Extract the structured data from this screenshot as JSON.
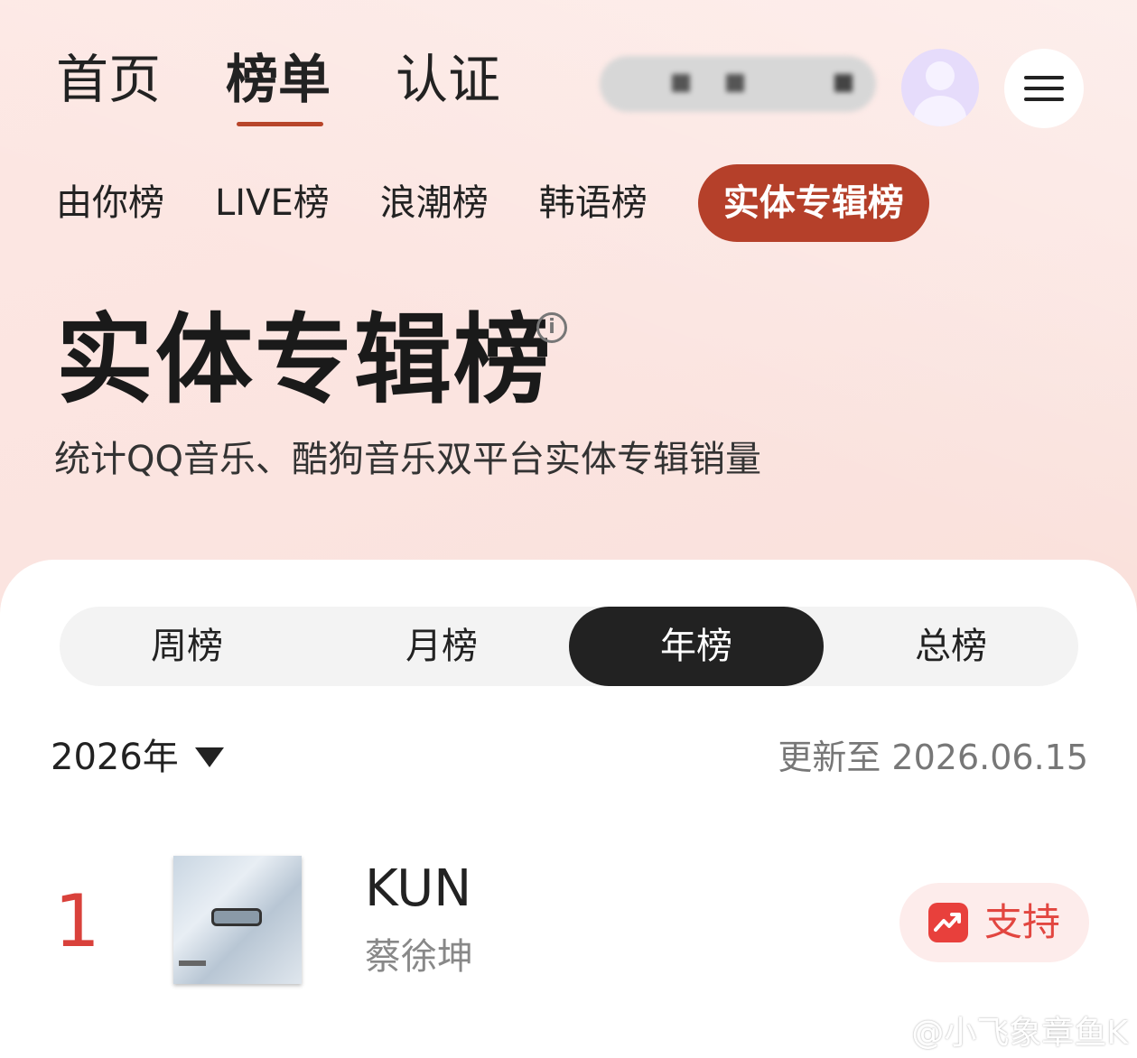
{
  "top_nav": {
    "tabs": [
      {
        "label": "首页"
      },
      {
        "label": "榜单",
        "active": true
      },
      {
        "label": "认证"
      }
    ]
  },
  "sub_nav": {
    "chips": [
      {
        "label": "由你榜"
      },
      {
        "label": "LIVE榜"
      },
      {
        "label": "浪潮榜"
      },
      {
        "label": "韩语榜"
      },
      {
        "label": "实体专辑榜",
        "active": true
      }
    ]
  },
  "header": {
    "title": "实体专辑榜",
    "info_icon": "info-icon",
    "subtitle": "统计QQ音乐、酷狗音乐双平台实体专辑销量"
  },
  "period_tabs": [
    {
      "label": "周榜"
    },
    {
      "label": "月榜"
    },
    {
      "label": "年榜",
      "active": true
    },
    {
      "label": "总榜"
    }
  ],
  "filter": {
    "year": "2026年",
    "updated": "更新至 2026.06.15"
  },
  "entries": [
    {
      "rank": "1",
      "title": "KUN",
      "artist": "蔡徐坤",
      "action_label": "支持"
    }
  ],
  "watermark": "@小飞象章鱼K",
  "colors": {
    "accent": "#b5402a",
    "rank": "#d9413b",
    "support": "#e24640"
  }
}
